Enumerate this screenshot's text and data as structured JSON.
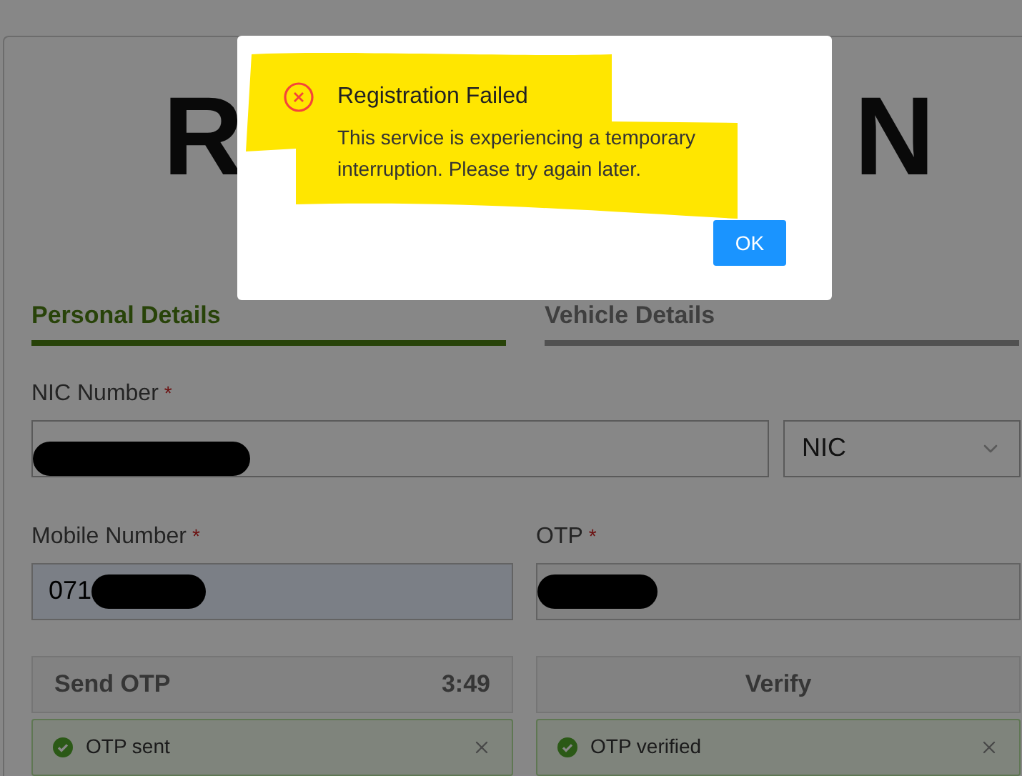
{
  "heading": {
    "left": "R",
    "right": "N"
  },
  "tabs": [
    {
      "label": "Personal Details",
      "selected": true
    },
    {
      "label": "Vehicle Details",
      "selected": false
    }
  ],
  "nic": {
    "label": "NIC Number",
    "marker": "*",
    "redacted": true,
    "id_type": "NIC"
  },
  "mobile": {
    "label": "Mobile Number",
    "marker": "*",
    "value": "071",
    "redacted": true
  },
  "otp": {
    "label": "OTP",
    "marker": "*",
    "redacted": true
  },
  "send_button": {
    "label": "Send OTP",
    "timer": "3:49",
    "disabled": true
  },
  "verify_button": {
    "label": "Verify",
    "disabled": true
  },
  "alerts": [
    {
      "kind": "success",
      "text": "OTP sent"
    },
    {
      "kind": "success",
      "text": "OTP verified"
    }
  ],
  "modal": {
    "kind": "error",
    "highlighted": true,
    "title": "Registration Failed",
    "message": "This service is experiencing a temporary interruption. Please try again later.",
    "button": "OK"
  }
}
